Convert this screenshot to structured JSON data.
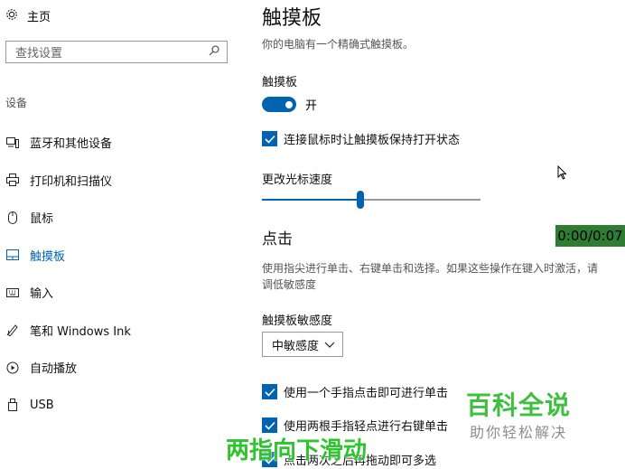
{
  "sidebar": {
    "home_label": "主页",
    "search_placeholder": "查找设置",
    "section_label": "设备",
    "items": [
      {
        "label": "蓝牙和其他设备",
        "icon": "bluetooth-devices-icon"
      },
      {
        "label": "打印机和扫描仪",
        "icon": "printer-icon"
      },
      {
        "label": "鼠标",
        "icon": "mouse-icon"
      },
      {
        "label": "触摸板",
        "icon": "touchpad-icon",
        "active": true
      },
      {
        "label": "输入",
        "icon": "keyboard-icon"
      },
      {
        "label": "笔和 Windows Ink",
        "icon": "pen-icon"
      },
      {
        "label": "自动播放",
        "icon": "autoplay-icon"
      },
      {
        "label": "USB",
        "icon": "usb-icon"
      }
    ]
  },
  "main": {
    "title": "触摸板",
    "subtitle": "你的电脑有一个精确式触摸板。",
    "touchpad_label": "触摸板",
    "toggle_state": "开",
    "toggle_on": true,
    "keep_on_mouse": "连接鼠标时让触摸板保持打开状态",
    "cursor_speed_label": "更改光标速度",
    "cursor_speed_value": 0.45,
    "section_click": "点击",
    "click_desc": "使用指尖进行单击、右键单击和选择。如果这些操作在键入时激活，请调低敏感度",
    "sensitivity_label": "触摸板敏感度",
    "sensitivity_value": "中敏感度",
    "check_single_tap": "使用一个手指点击即可进行单击",
    "check_two_finger": "使用两根手指轻点进行右键单击",
    "check_partial": "点击两次之后再拖动即可多选"
  },
  "overlay": {
    "timer": "0:00/0:07",
    "watermark_main": "百科全说",
    "watermark_sub": "助你轻松解决",
    "caption": "两指向下滑动"
  },
  "colors": {
    "accent": "#0063b1",
    "timer_bg": "#2e7d32",
    "watermark": "#3fbf40"
  }
}
